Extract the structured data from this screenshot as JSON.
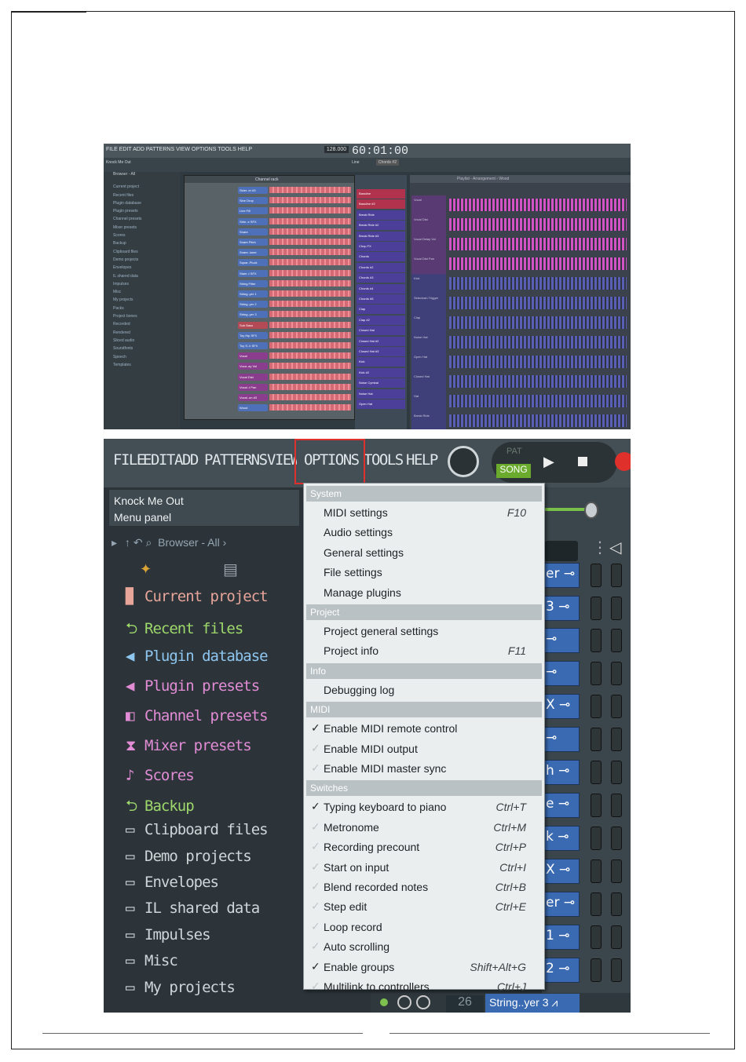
{
  "top_screenshot": {
    "menu": "FILE EDIT ADD PATTERNS VIEW OPTIONS TOOLS HELP",
    "tempo": "128.000",
    "time": "60:01:00",
    "song_name": "Knock Me Out",
    "pattern": "Chords #2",
    "snap": "Line",
    "channel_rack_title": "Channel rack",
    "playlist_title": "Playlist - Arrangement › Wood",
    "browser_title": "Browser - All",
    "browser_items": [
      "Current project",
      "Recent files",
      "Plugin database",
      "Plugin presets",
      "Channel presets",
      "Mixer presets",
      "Scores",
      "Backup",
      "Clipboard files",
      "Demo projects",
      "Envelopes",
      "IL shared data",
      "Impulses",
      "Misc",
      "My projects",
      "Packs",
      "Project bones",
      "Recorded",
      "Rendered",
      "Sliced audio",
      "Soundfonts",
      "Speech",
      "Templates"
    ],
    "channels": [
      "Sider..er #3",
      "Sine Drop",
      "Line Fill",
      "Strin..e SFX",
      "Snare",
      "Snare Pitch",
      "Snare..lume",
      "Squar..Pluck",
      "Stam..t SFX",
      "String Filter",
      "String..yer 1",
      "String..yer 2",
      "String..yer 3",
      "Sub Bass",
      "Toy Hip SFX",
      "Toy S..h SFX",
      "Vocal",
      "Voca..ay Vol",
      "Vocal Dist",
      "Vocal..t Pan",
      "Vocal..on #3",
      "Wood"
    ],
    "mixer_tracks": [
      "Bassline",
      "Bassline #2",
      "Break Ride",
      "Break Ride #2",
      "Break Ride #3",
      "Chop FX",
      "Chords",
      "Chords #2",
      "Chords #3",
      "Chords #4",
      "Chords #5",
      "Clap",
      "Clap #2",
      "Closed Hat",
      "Closed Hat #2",
      "Closed Hat #3",
      "Kick",
      "Kick #2",
      "Noise Cymbal",
      "Noise Hat",
      "Open Hat"
    ],
    "playlist_tracks": [
      "Vocal",
      "Vocal Dist",
      "Vocal Delay Vol",
      "Vocal Dist Pan",
      "Kick",
      "Sidechain Trigger",
      "Clap",
      "Noise Hat",
      "Open Hat",
      "Closed Hat",
      "Hat",
      "Break Ride"
    ]
  },
  "menubar": {
    "items": [
      "FILE",
      "EDIT",
      "ADD",
      "PATTERNS",
      "VIEW",
      "OPTIONS",
      "TOOLS",
      "HELP"
    ],
    "highlighted": "OPTIONS"
  },
  "transport": {
    "pat": "PAT",
    "song": "SONG"
  },
  "hint_panel": {
    "line1": "Knock Me Out",
    "line2": "Menu panel"
  },
  "browser": {
    "title": "Browser - All",
    "items": [
      {
        "label": "Current project",
        "icon": "project-file-icon",
        "color": "#e8a59a"
      },
      {
        "label": "Recent files",
        "icon": "folder-recent-icon",
        "color": "#9ed86c"
      },
      {
        "label": "Plugin database",
        "icon": "plugin-icon",
        "color": "#8ec6f0"
      },
      {
        "label": "Plugin presets",
        "icon": "plugin-preset-icon",
        "color": "#e28cd6"
      },
      {
        "label": "Channel presets",
        "icon": "channel-preset-icon",
        "color": "#e28cd6"
      },
      {
        "label": "Mixer presets",
        "icon": "mixer-preset-icon",
        "color": "#e28cd6"
      },
      {
        "label": "Scores",
        "icon": "note-icon",
        "color": "#e28cd6"
      },
      {
        "label": "Backup",
        "icon": "folder-backup-icon",
        "color": "#9ed86c"
      },
      {
        "label": "Clipboard files",
        "icon": "folder-icon",
        "color": "#cfd6d9"
      },
      {
        "label": "Demo projects",
        "icon": "folder-icon",
        "color": "#cfd6d9"
      },
      {
        "label": "Envelopes",
        "icon": "folder-icon",
        "color": "#cfd6d9"
      },
      {
        "label": "IL shared data",
        "icon": "folder-icon",
        "color": "#cfd6d9"
      },
      {
        "label": "Impulses",
        "icon": "folder-icon",
        "color": "#cfd6d9"
      },
      {
        "label": "Misc",
        "icon": "folder-icon",
        "color": "#cfd6d9"
      },
      {
        "label": "My projects",
        "icon": "folder-icon",
        "color": "#cfd6d9"
      }
    ]
  },
  "channel_buttons": [
    "er",
    "3",
    "",
    "",
    "X",
    "",
    "h",
    "e",
    "k",
    "X",
    "er",
    "1",
    "2"
  ],
  "bottom_channel": {
    "number": "26",
    "name": "String..yer 3"
  },
  "options_menu": {
    "sections": [
      {
        "title": "System",
        "items": [
          {
            "label": "MIDI settings",
            "shortcut": "F10",
            "check": null
          },
          {
            "label": "Audio settings",
            "shortcut": "",
            "check": null
          },
          {
            "label": "General settings",
            "shortcut": "",
            "check": null
          },
          {
            "label": "File settings",
            "shortcut": "",
            "check": null
          },
          {
            "label": "Manage plugins",
            "shortcut": "",
            "check": null
          }
        ]
      },
      {
        "title": "Project",
        "items": [
          {
            "label": "Project general settings",
            "shortcut": "",
            "check": null
          },
          {
            "label": "Project info",
            "shortcut": "F11",
            "check": null
          }
        ]
      },
      {
        "title": "Info",
        "items": [
          {
            "label": "Debugging log",
            "shortcut": "",
            "check": null
          }
        ]
      },
      {
        "title": "MIDI",
        "items": [
          {
            "label": "Enable MIDI remote control",
            "shortcut": "",
            "check": true
          },
          {
            "label": "Enable MIDI output",
            "shortcut": "",
            "check": false
          },
          {
            "label": "Enable MIDI master sync",
            "shortcut": "",
            "check": false
          }
        ]
      },
      {
        "title": "Switches",
        "items": [
          {
            "label": "Typing keyboard to piano",
            "shortcut": "Ctrl+T",
            "check": true
          },
          {
            "label": "Metronome",
            "shortcut": "Ctrl+M",
            "check": false
          },
          {
            "label": "Recording precount",
            "shortcut": "Ctrl+P",
            "check": false
          },
          {
            "label": "Start on input",
            "shortcut": "Ctrl+I",
            "check": false
          },
          {
            "label": "Blend recorded notes",
            "shortcut": "Ctrl+B",
            "check": false
          },
          {
            "label": "Step edit",
            "shortcut": "Ctrl+E",
            "check": false
          },
          {
            "label": "Loop record",
            "shortcut": "",
            "check": false
          },
          {
            "label": "Auto scrolling",
            "shortcut": "",
            "check": false
          },
          {
            "label": "Enable groups",
            "shortcut": "Shift+Alt+G",
            "check": true
          },
          {
            "label": "Multilink to controllers",
            "shortcut": "Ctrl+J",
            "check": false
          }
        ]
      }
    ]
  }
}
